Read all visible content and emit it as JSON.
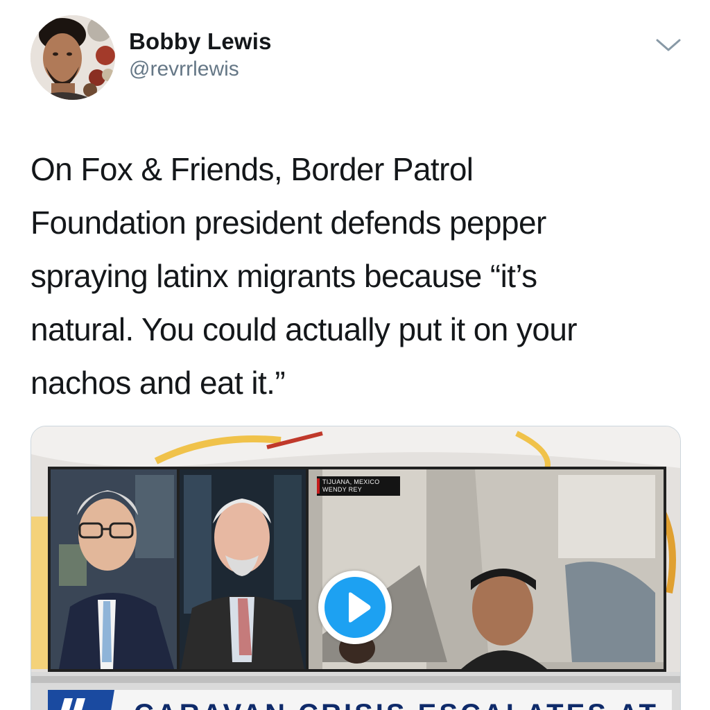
{
  "tweet": {
    "display_name": "Bobby Lewis",
    "handle": "@revrrlewis",
    "text_lines": [
      "On Fox & Friends, Border Patrol",
      "Foundation president defends pepper",
      "spraying latinx migrants because “it’s",
      "natural. You could actually put it on your",
      "nachos and eat it.”"
    ]
  },
  "media": {
    "type": "video",
    "locator_line1": "TIJUANA, MEXICO",
    "locator_line2": "WENDY REY",
    "chyron_text": "CARAVAN CRISIS ESCALATES AT U.S. BORDER"
  },
  "icons": {
    "menu": "chevron-down-icon",
    "play": "play-icon"
  },
  "colors": {
    "text": "#14171a",
    "secondary_text": "#657786",
    "accent": "#1da1f2",
    "caret": "#8899a6"
  }
}
